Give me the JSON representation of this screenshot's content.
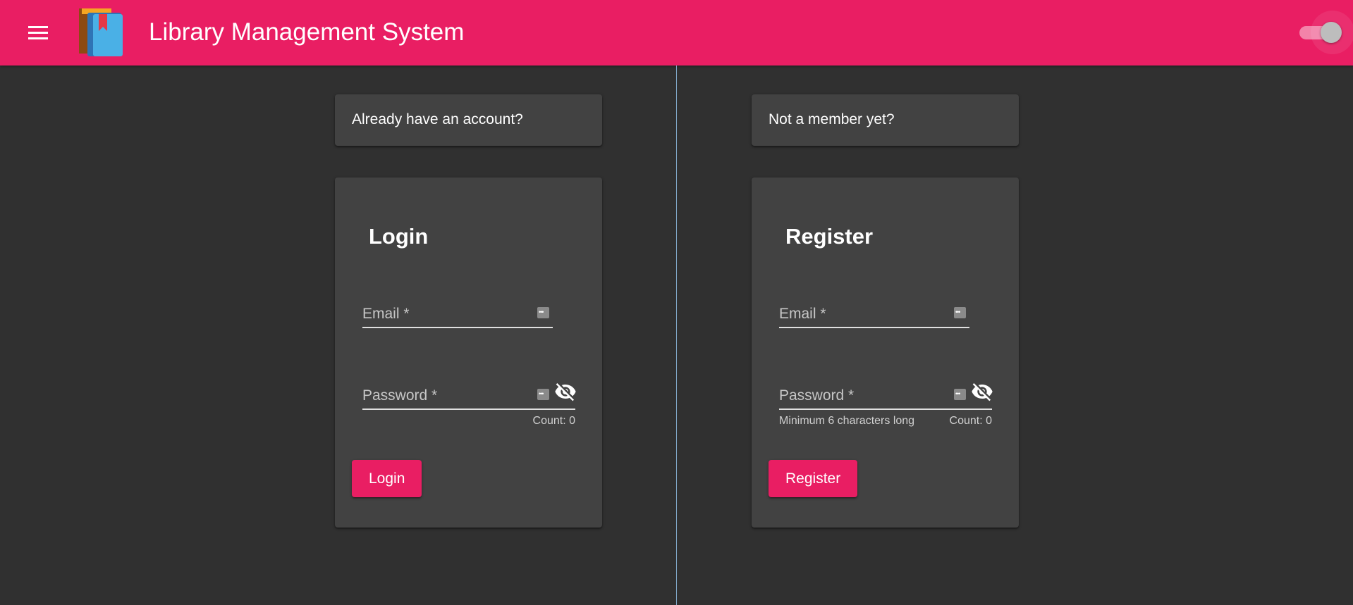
{
  "header": {
    "title": "Library Management System",
    "menu_icon": "menu-icon",
    "logo_icon": "book-logo-icon",
    "theme_toggle_on": true,
    "accent_color": "#e91e63"
  },
  "login": {
    "prompt": "Already have an account?",
    "title": "Login",
    "email_label": "Email *",
    "email_value": "",
    "password_label": "Password *",
    "password_value": "",
    "password_count": "Count: 0",
    "submit_label": "Login"
  },
  "register": {
    "prompt": "Not a member yet?",
    "title": "Register",
    "email_label": "Email *",
    "email_value": "",
    "password_label": "Password *",
    "password_value": "",
    "password_hint": "Minimum 6 characters long",
    "password_count": "Count: 0",
    "submit_label": "Register"
  },
  "colors": {
    "background": "#303030",
    "card": "#424242",
    "toolbar": "#e91e63"
  }
}
